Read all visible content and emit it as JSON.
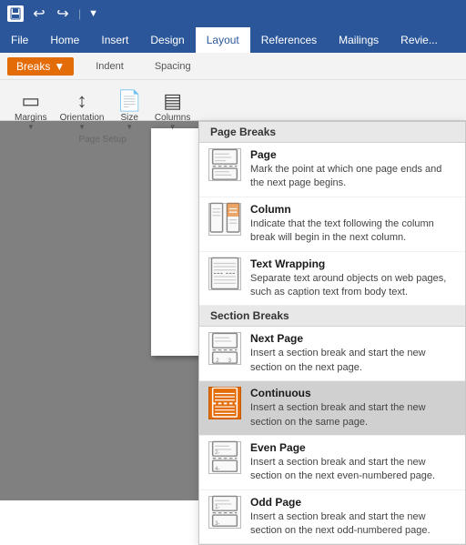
{
  "titlebar": {
    "save_icon": "💾",
    "undo_icon": "↩",
    "redo_icon": "↪",
    "more_icon": "▼"
  },
  "menubar": {
    "items": [
      "File",
      "Home",
      "Insert",
      "Design",
      "Layout",
      "References",
      "Mailings",
      "Revie..."
    ],
    "active": "Layout"
  },
  "ribbon": {
    "breaks_label": "Breaks",
    "breaks_caret": "▼",
    "indent_label": "Indent",
    "spacing_label": "Spacing",
    "groups": [
      {
        "label": "Page Setup",
        "icons": [
          "Margins",
          "Orientation",
          "Size",
          "Columns"
        ]
      }
    ]
  },
  "dropdown": {
    "sections": [
      {
        "header": "Page Breaks",
        "items": [
          {
            "id": "page",
            "title": "Page",
            "desc": "Mark the point at which one page ends and the next page begins."
          },
          {
            "id": "column",
            "title": "Column",
            "desc": "Indicate that the text following the column break will begin in the next column."
          },
          {
            "id": "text-wrapping",
            "title": "Text Wrapping",
            "desc": "Separate text around objects on web pages, such as caption text from body text."
          }
        ]
      },
      {
        "header": "Section Breaks",
        "items": [
          {
            "id": "next-page",
            "title": "Next Page",
            "desc": "Insert a section break and start the new section on the next page."
          },
          {
            "id": "continuous",
            "title": "Continuous",
            "desc": "Insert a section break and start the new section on the same page.",
            "highlighted": true
          },
          {
            "id": "even-page",
            "title": "Even Page",
            "desc": "Insert a section break and start the new section on the next even-numbered page."
          },
          {
            "id": "odd-page",
            "title": "Odd Page",
            "desc": "Insert a section break and start the new section on the next odd-numbered page."
          }
        ]
      }
    ]
  }
}
